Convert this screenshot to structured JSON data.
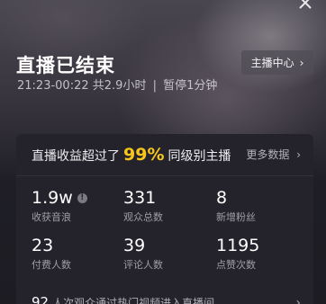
{
  "header": {
    "close_icon": "close-icon",
    "title": "直播已结束",
    "time_range": "21:23-00:22",
    "duration": "共2.9小时",
    "separator": "|",
    "pause": "暂停1分钟",
    "anchor_center_label": "主播中心",
    "anchor_center_chevron": "›"
  },
  "card": {
    "headline_prefix": "直播收益超过了",
    "headline_percent": "99%",
    "headline_suffix": "同级别主播",
    "more_label": "更多数据",
    "more_chevron": "›",
    "accent_color": "#f8c51c",
    "stats": [
      {
        "value": "1.9w",
        "label": "收获音浪",
        "info_icon": "info-icon"
      },
      {
        "value": "331",
        "label": "观众总数"
      },
      {
        "value": "8",
        "label": "新增粉丝"
      },
      {
        "value": "23",
        "label": "付费人数"
      },
      {
        "value": "39",
        "label": "评论人数"
      },
      {
        "value": "1195",
        "label": "点赞次数"
      }
    ],
    "footer_count": "92",
    "footer_text": "人次观众通过热门视频进入直播间",
    "footer_chevron": "›"
  }
}
